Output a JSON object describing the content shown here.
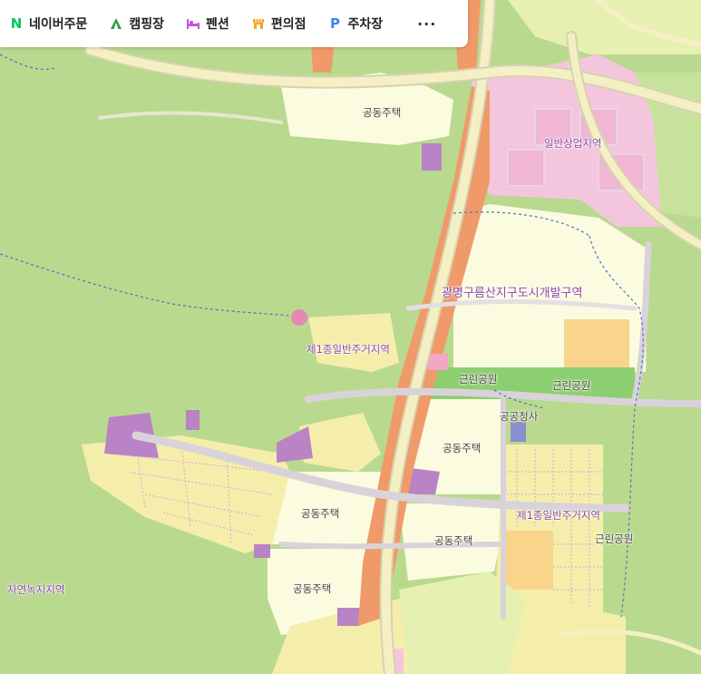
{
  "toolbar": {
    "items": [
      {
        "label": "네이버주문",
        "icon": "naver-n-icon",
        "color": "#03c75a"
      },
      {
        "label": "캠핑장",
        "icon": "tent-icon",
        "color": "#2e9d46"
      },
      {
        "label": "펜션",
        "icon": "bed-icon",
        "color": "#c653d9"
      },
      {
        "label": "편의점",
        "icon": "store-icon",
        "color": "#f5a623"
      },
      {
        "label": "주차장",
        "icon": "parking-p-icon",
        "color": "#3d84f5"
      }
    ],
    "more_label": "···"
  },
  "labels": {
    "housing_1": "공동주택",
    "commercial": "일반상업지역",
    "dev_district": "광명구름산지구도시개발구역",
    "residential_1": "제1종일반주거지역",
    "park_1": "근린공원",
    "park_2": "근린공원",
    "office": "공공청사",
    "housing_2": "공동주택",
    "residential_2": "제1종일반주거지역",
    "housing_3": "공동주택",
    "housing_4": "공동주택",
    "park_3": "근린공원",
    "housing_5": "공동주택",
    "green_zone": "자연녹지지역"
  },
  "colors": {
    "forest": "#b9d98f",
    "green_zone_dark": "#a8cf7c",
    "residential": "#f5eeaa",
    "housing": "#fbfbe0",
    "commercial": "#f4c6de",
    "arterial": "#f09a6a",
    "road": "#f4f0c4",
    "park": "#8ccf70",
    "public": "#b983c6",
    "boundary": "#4b73c9"
  }
}
